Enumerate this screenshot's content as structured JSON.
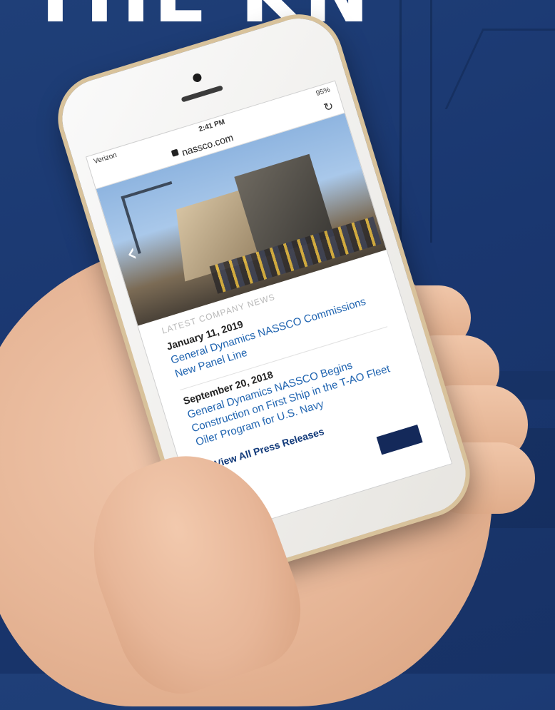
{
  "background": {
    "banner_text": "THE KN",
    "colors": {
      "navy": "#1f3f78",
      "skin": "#e6b596",
      "phone_gold": "#d8c29b"
    }
  },
  "phone": {
    "status": {
      "carrier": "Verizon",
      "time": "2:41 PM",
      "battery": "95%"
    },
    "url": "nassco.com",
    "hero": {
      "prev_arrow": "‹"
    },
    "section_title": "LATEST COMPANY NEWS",
    "news": [
      {
        "date": "January 11, 2019",
        "headline": "General Dynamics NASSCO Commissions New Panel Line"
      },
      {
        "date": "September 20, 2018",
        "headline": "General Dynamics NASSCO Begins Construction on First Ship in the T-AO Fleet Oiler Program for U.S. Navy"
      }
    ],
    "view_all": ">>View All Press Releases"
  }
}
